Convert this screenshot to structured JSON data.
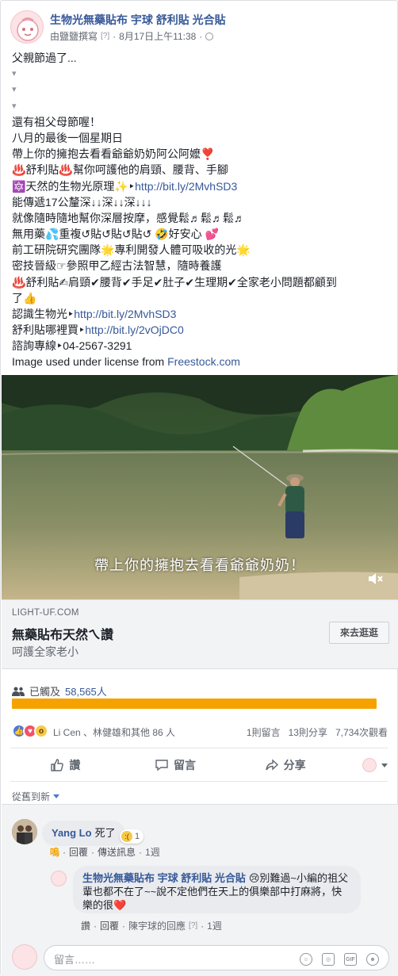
{
  "post": {
    "page_name": "生物光無藥貼布 宇球 舒利貼 光合貼",
    "author_line": "由鹽鹽撰寫",
    "help": "[?]",
    "timestamp": "8月17日上午11:38",
    "audience_icon": "globe-icon"
  },
  "body": {
    "lines": [
      "父親節過了...",
      "▾",
      "▾",
      "▾",
      "還有祖父母節喔！",
      "八月的最後一個星期日",
      "帶上你的擁抱去看看爺爺奶奶阿公阿嬤❣️",
      "♨️舒利貼♨️幫你呵護他的肩頸、腰背、手腳",
      "🔯天然的生物光原理✨",
      "能傳遞17公釐深↓↓深↓↓深↓↓↓",
      "就像隨時隨地幫你深層按摩，感覺鬆♬鬆♬鬆♬",
      "無用藥💦重複↺貼↺貼↺貼↺ 🤣好安心 💕",
      "前工研院研究團隊🌟專利開發人體可吸收的光🌟",
      "密技晉級☞參照甲乙經古法智慧，隨時養護",
      "♨️舒利貼✍肩頸✔腰背✔手足✔肚子✔生理期✔全家老小問題都顧到",
      "了👍",
      "認識生物光",
      "舒利貼哪裡買",
      "諮詢專線‣04-2567-3291"
    ],
    "link1": "http://bit.ly/2MvhSD3",
    "link2": "http://bit.ly/2MvhSD3",
    "link3": "http://bit.ly/2vOjDC0",
    "arrow": "‣",
    "credit_text": "Image used under license from ",
    "credit_link": "Freestock.com"
  },
  "video": {
    "caption": "帶上你的擁抱去看看爺爺奶奶！",
    "mute_icon": "speaker-mute-icon"
  },
  "link_preview": {
    "domain": "LIGHT-UF.COM",
    "title": "無藥貼布天然ㄟ讚",
    "description": "呵護全家老小",
    "button": "來去逛逛"
  },
  "reach": {
    "label": "已觸及",
    "count": "58,565人",
    "progress": 1.0,
    "bar_color": "#f5a200"
  },
  "reactions": {
    "names": "Li Cen 、林健雄和其他 86 人",
    "comments": "1則留言",
    "shares": "13則分享",
    "views": "7,734次觀看"
  },
  "actions": {
    "like": "讚",
    "comment": "留言",
    "share": "分享"
  },
  "sort": {
    "label": "從舊到新"
  },
  "comments": [
    {
      "author": "Yang Lo",
      "text": "死了",
      "reaction_count": "1",
      "like": "嗚",
      "reply": "回覆",
      "message": "傳送訊息",
      "time": "1週"
    },
    {
      "author": "生物光無藥貼布 宇球 舒利貼 光合貼",
      "text": "😢別難過~小編的祖父輩也都不在了~~說不定他們在天上的俱樂部中打麻將，快樂的很❤️",
      "like": "讚",
      "reply": "回覆",
      "replier": "陳宇球的回應",
      "help": "[?]",
      "time": "1週"
    }
  ],
  "reply_box": {
    "placeholder": "留言……",
    "icons": [
      "emoji-icon",
      "camera-icon",
      "gif-icon",
      "sticker-icon"
    ]
  }
}
